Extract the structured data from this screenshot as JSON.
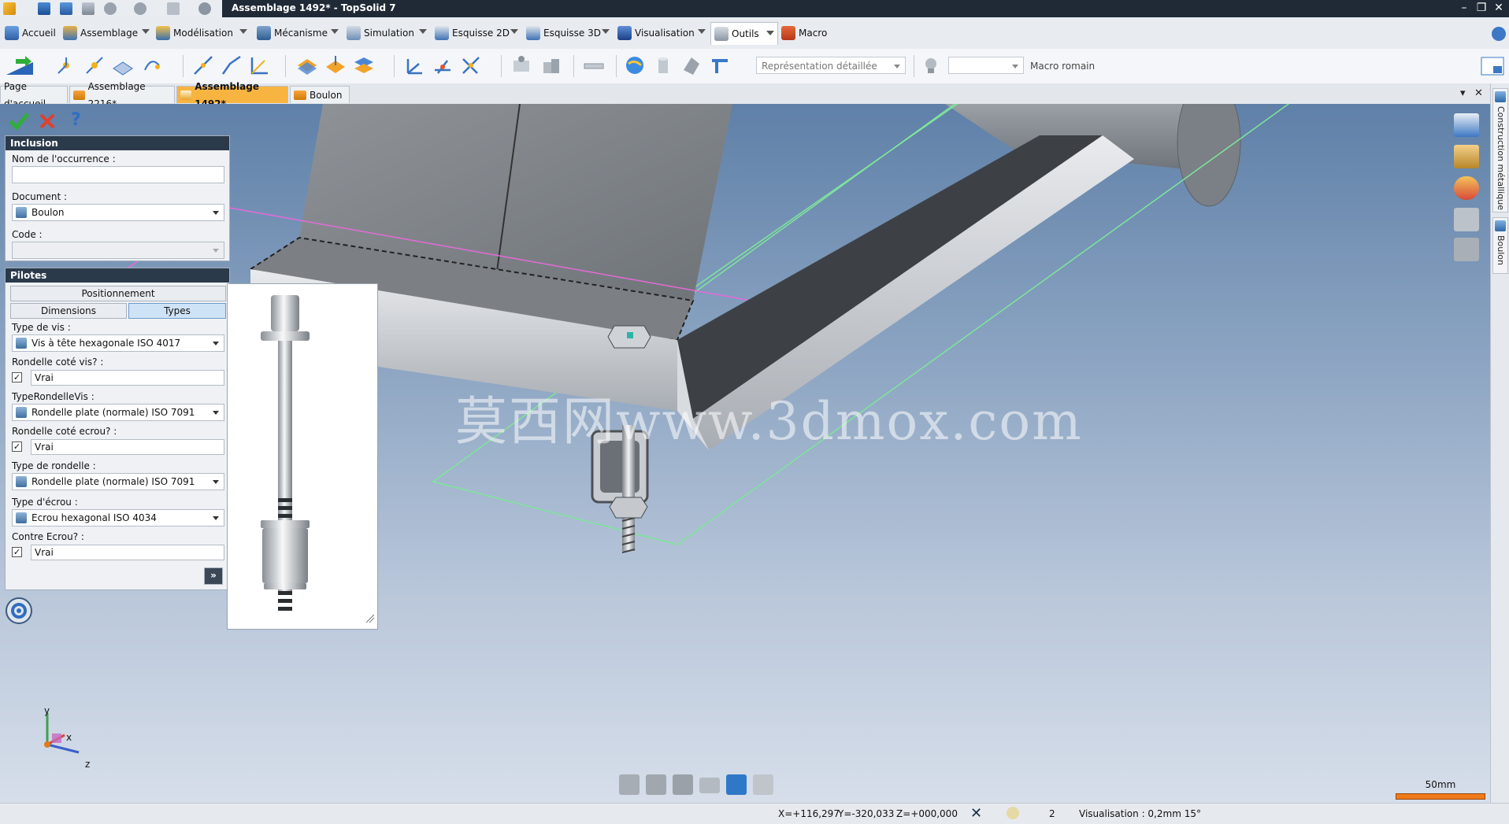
{
  "window": {
    "title": "Assemblage 1492* - TopSolid 7",
    "controls": [
      "–",
      "❐",
      "✕"
    ]
  },
  "menu": {
    "items": [
      {
        "label": "Accueil"
      },
      {
        "label": "Assemblage"
      },
      {
        "label": "Modélisation"
      },
      {
        "label": "Mécanisme"
      },
      {
        "label": "Simulation"
      },
      {
        "label": "Esquisse 2D"
      },
      {
        "label": "Esquisse 3D"
      },
      {
        "label": "Visualisation"
      },
      {
        "label": "Outils"
      },
      {
        "label": "Macro"
      }
    ]
  },
  "toolbar": {
    "representation": "Représentation détaillée",
    "macro_label": "Macro romain"
  },
  "tabs": {
    "items": [
      {
        "label": "Page d'accueil"
      },
      {
        "label": "Assemblage 2216*"
      },
      {
        "label": "Assemblage 1492*"
      },
      {
        "label": "Boulon"
      }
    ],
    "active": "Assemblage 1492*"
  },
  "panel": {
    "inclusion": {
      "header": "Inclusion",
      "occurrence_label": "Nom de l'occurrence :",
      "occurrence_value": "",
      "document_label": "Document :",
      "document_value": "Boulon",
      "code_label": "Code :",
      "code_value": ""
    },
    "pilotes": {
      "header": "Pilotes",
      "positionnement": "Positionnement",
      "dimensions": "Dimensions",
      "types": "Types",
      "vis_label": "Type de vis :",
      "vis_value": "Vis à tête hexagonale ISO 4017",
      "rondelle_vis_label": "Rondelle coté vis? :",
      "rondelle_vis_value": "Vrai",
      "type_rondelle_vis_label": "TypeRondelleVis :",
      "type_rondelle_vis_value": "Rondelle plate (normale) ISO 7091",
      "rondelle_ecrou_label": "Rondelle coté ecrou? :",
      "rondelle_ecrou_value": "Vrai",
      "type_rondelle_label": "Type de rondelle :",
      "type_rondelle_value": "Rondelle plate (normale) ISO 7091",
      "ecrou_label": "Type d'écrou :",
      "ecrou_value": "Ecrou hexagonal ISO 4034",
      "contre_ecrou_label": "Contre Ecrou? :",
      "contre_ecrou_value": "Vrai",
      "more_button": "»"
    }
  },
  "side_tabs": {
    "construction": "Construction métallique",
    "boulon": "Boulon"
  },
  "viewport": {
    "watermark": "莫西网www.3dmox.com",
    "axes": {
      "x": "x",
      "y": "y",
      "z": "z"
    },
    "scale_label": "50mm"
  },
  "status": {
    "x": "X=+116,297",
    "y": "Y=-320,033",
    "z": "Z=+000,000",
    "count": "2",
    "visualisation": "Visualisation : 0,2mm 15°"
  },
  "colors": {
    "titlebar": "#1f2a36",
    "active_tab": "#f7b441",
    "panel_header": "#2b3a4b",
    "scale_bar": "#f07a1a"
  }
}
